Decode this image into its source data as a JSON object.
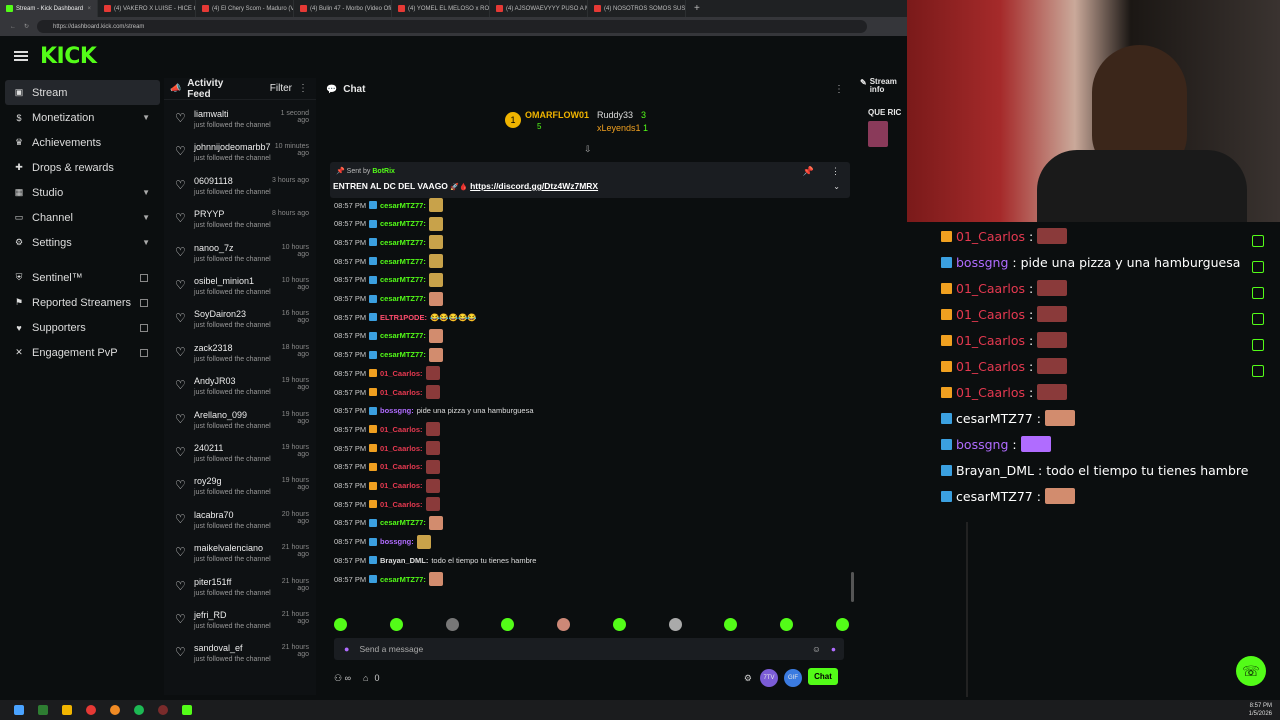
{
  "browser": {
    "tabs": [
      {
        "label": "Stream - Kick Dashboard",
        "active": true
      },
      {
        "label": "(4) VAKERO X LUISE - HICE CANC",
        "active": false
      },
      {
        "label": "(4) El Chery Scom - Maduro (Vid",
        "active": false
      },
      {
        "label": "(4) Bulin 47 - Morbo (Video Oficia",
        "active": false
      },
      {
        "label": "(4) YOMEL EL MELOSO x ROCHY",
        "active": false
      },
      {
        "label": "(4) AJSOWAEVYYY PUSO A MIN",
        "active": false
      },
      {
        "label": "(4) NOSOTROS SOMOS SUS AMIG",
        "active": false
      }
    ],
    "url": "https://dashboard.kick.com/stream"
  },
  "app": {
    "logo": "KICK"
  },
  "sidebar": {
    "items": [
      {
        "label": "Stream",
        "icon": "stream-icon",
        "active": true,
        "chevron": false
      },
      {
        "label": "Monetization",
        "icon": "dollar-icon",
        "chevron": true
      },
      {
        "label": "Achievements",
        "icon": "trophy-icon",
        "chevron": false
      },
      {
        "label": "Drops & rewards",
        "icon": "gift-icon",
        "chevron": false
      },
      {
        "label": "Studio",
        "icon": "studio-icon",
        "chevron": true
      },
      {
        "label": "Channel",
        "icon": "channel-icon",
        "chevron": true
      },
      {
        "label": "Settings",
        "icon": "gear-icon",
        "chevron": true
      }
    ],
    "external": [
      {
        "label": "Sentinel™",
        "icon": "shield-icon"
      },
      {
        "label": "Reported Streamers",
        "icon": "flag-icon"
      },
      {
        "label": "Supporters",
        "icon": "users-icon"
      },
      {
        "label": "Engagement PvP",
        "icon": "pvp-icon"
      }
    ]
  },
  "activity": {
    "title": "Activity Feed",
    "filter": "Filter",
    "items": [
      {
        "name": "liamwalti",
        "time": "1 second ago",
        "desc": "just followed the channel"
      },
      {
        "name": "johnnijodeomarbb7",
        "time": "10 minutes ago",
        "desc": "just followed the channel"
      },
      {
        "name": "06091118",
        "time": "3 hours ago",
        "desc": "just followed the channel"
      },
      {
        "name": "PRYYP",
        "time": "8 hours ago",
        "desc": "just followed the channel"
      },
      {
        "name": "nanoo_7z",
        "time": "10 hours ago",
        "desc": "just followed the channel"
      },
      {
        "name": "osibel_minion1",
        "time": "10 hours ago",
        "desc": "just followed the channel"
      },
      {
        "name": "SoyDairon23",
        "time": "16 hours ago",
        "desc": "just followed the channel"
      },
      {
        "name": "zack2318",
        "time": "18 hours ago",
        "desc": "just followed the channel"
      },
      {
        "name": "AndyJR03",
        "time": "19 hours ago",
        "desc": "just followed the channel"
      },
      {
        "name": "Arellano_099",
        "time": "19 hours ago",
        "desc": "just followed the channel"
      },
      {
        "name": "240211",
        "time": "19 hours ago",
        "desc": "just followed the channel"
      },
      {
        "name": "roy29g",
        "time": "19 hours ago",
        "desc": "just followed the channel"
      },
      {
        "name": "lacabra70",
        "time": "20 hours ago",
        "desc": "just followed the channel"
      },
      {
        "name": "maikelvalenciano",
        "time": "21 hours ago",
        "desc": "just followed the channel"
      },
      {
        "name": "piter151ff",
        "time": "21 hours ago",
        "desc": "just followed the channel"
      },
      {
        "name": "jefri_RD",
        "time": "21 hours ago",
        "desc": "just followed the channel"
      },
      {
        "name": "sandoval_ef",
        "time": "21 hours ago",
        "desc": "just followed the channel"
      }
    ]
  },
  "chat": {
    "title": "Chat",
    "podium": {
      "first": "OMARFLOW01",
      "first_count": "5",
      "second": "Ruddy33",
      "second_count": "3",
      "third": "xLeyends1",
      "third_count": "1"
    },
    "pinned": {
      "sent_by_label": "Sent by",
      "sent_by": "BotRix",
      "text": "ENTREN AL DC DEL VAAGO",
      "link": "https://discord.gg/Dtz4Wz7MRX"
    },
    "messages": [
      {
        "time": "08:57 PM",
        "user": "cesarMTZ77:",
        "color": "#53fc18",
        "text": "",
        "emote": "#c8a24a"
      },
      {
        "time": "08:57 PM",
        "user": "cesarMTZ77:",
        "color": "#53fc18",
        "text": "",
        "emote": "#c8a24a"
      },
      {
        "time": "08:57 PM",
        "user": "cesarMTZ77:",
        "color": "#53fc18",
        "text": "",
        "emote": "#c8a24a"
      },
      {
        "time": "08:57 PM",
        "user": "cesarMTZ77:",
        "color": "#53fc18",
        "text": "",
        "emote": "#c8a24a"
      },
      {
        "time": "08:57 PM",
        "user": "cesarMTZ77:",
        "color": "#53fc18",
        "text": "",
        "emote": "#c8a24a"
      },
      {
        "time": "08:57 PM",
        "user": "cesarMTZ77:",
        "color": "#53fc18",
        "text": "",
        "emote": "#d28c6e"
      },
      {
        "time": "08:57 PM",
        "user": "ELTR1PODE:",
        "color": "#ff4d6d",
        "text": "😂😂😂😂😂",
        "emote": ""
      },
      {
        "time": "08:57 PM",
        "user": "cesarMTZ77:",
        "color": "#53fc18",
        "text": "",
        "emote": "#d28c6e"
      },
      {
        "time": "08:57 PM",
        "user": "cesarMTZ77:",
        "color": "#53fc18",
        "text": "",
        "emote": "#d28c6e"
      },
      {
        "time": "08:57 PM",
        "user": "01_Caarlos:",
        "color": "#e53950",
        "text": "",
        "emote": "#8a3a3a"
      },
      {
        "time": "08:57 PM",
        "user": "01_Caarlos:",
        "color": "#e53950",
        "text": "",
        "emote": "#8a3a3a"
      },
      {
        "time": "08:57 PM",
        "user": "bossgng:",
        "color": "#b06cff",
        "text": "pide una pizza y una hamburguesa",
        "emote": ""
      },
      {
        "time": "08:57 PM",
        "user": "01_Caarlos:",
        "color": "#e53950",
        "text": "",
        "emote": "#8a3a3a"
      },
      {
        "time": "08:57 PM",
        "user": "01_Caarlos:",
        "color": "#e53950",
        "text": "",
        "emote": "#8a3a3a"
      },
      {
        "time": "08:57 PM",
        "user": "01_Caarlos:",
        "color": "#e53950",
        "text": "",
        "emote": "#8a3a3a"
      },
      {
        "time": "08:57 PM",
        "user": "01_Caarlos:",
        "color": "#e53950",
        "text": "",
        "emote": "#8a3a3a"
      },
      {
        "time": "08:57 PM",
        "user": "01_Caarlos:",
        "color": "#e53950",
        "text": "",
        "emote": "#8a3a3a"
      },
      {
        "time": "08:57 PM",
        "user": "cesarMTZ77:",
        "color": "#53fc18",
        "text": "",
        "emote": "#d28c6e"
      },
      {
        "time": "08:57 PM",
        "user": "bossgng:",
        "color": "#b06cff",
        "text": "",
        "emote": "#c9a34a"
      },
      {
        "time": "08:57 PM",
        "user": "Brayan_DML:",
        "color": "#dddddd",
        "text": "todo el tiempo tu tienes hambre",
        "emote": ""
      },
      {
        "time": "08:57 PM",
        "user": "cesarMTZ77:",
        "color": "#53fc18",
        "text": "",
        "emote": "#d28c6e"
      }
    ],
    "placeholder": "Send a message",
    "points": "0",
    "send_label": "Chat"
  },
  "stream_info": {
    "title": "Stream info",
    "preview": "QUE RIC"
  },
  "overlay_chat": [
    {
      "user": "01_Caarlos",
      "color": "#e53950",
      "text": "",
      "emote": "#8a3a3a"
    },
    {
      "user": "bossgng",
      "color": "#b06cff",
      "text": "pide una pizza y una hamburguesa",
      "emote": ""
    },
    {
      "user": "01_Caarlos",
      "color": "#e53950",
      "text": "",
      "emote": "#8a3a3a"
    },
    {
      "user": "01_Caarlos",
      "color": "#e53950",
      "text": "",
      "emote": "#8a3a3a"
    },
    {
      "user": "01_Caarlos",
      "color": "#e53950",
      "text": "",
      "emote": "#8a3a3a"
    },
    {
      "user": "01_Caarlos",
      "color": "#e53950",
      "text": "",
      "emote": "#8a3a3a"
    },
    {
      "user": "01_Caarlos",
      "color": "#e53950",
      "text": "",
      "emote": "#8a3a3a"
    },
    {
      "user": "cesarMTZ77",
      "color": "#53fc18",
      "text": "",
      "emote": "#d28c6e"
    },
    {
      "user": "bossgng",
      "color": "#b06cff",
      "text": "",
      "emote": "#b06cff"
    },
    {
      "user": "Brayan_DML",
      "color": "#53fc18",
      "text": "todo el tiempo tu tienes hambre",
      "emote": ""
    },
    {
      "user": "cesarMTZ77",
      "color": "#53fc18",
      "text": "",
      "emote": "#d28c6e"
    }
  ],
  "clock": {
    "time": "8:57 PM",
    "date": "1/5/2026"
  },
  "colors": {
    "accent": "#53fc18",
    "background": "#0b0e0f",
    "panel": "#0e1113"
  }
}
